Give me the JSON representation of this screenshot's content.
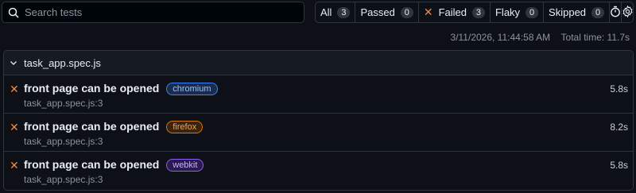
{
  "search": {
    "placeholder": "Search tests"
  },
  "filters": [
    {
      "label": "All",
      "count": "3"
    },
    {
      "label": "Passed",
      "count": "0"
    },
    {
      "label": "Failed",
      "count": "3"
    },
    {
      "label": "Flaky",
      "count": "0"
    },
    {
      "label": "Skipped",
      "count": "0"
    }
  ],
  "meta": {
    "datetime": "3/11/2026, 11:44:58 AM",
    "total_time": "Total time: 11.7s"
  },
  "file": {
    "name": "task_app.spec.js"
  },
  "tests": [
    {
      "title": "front page can be opened",
      "project": "chromium",
      "location": "task_app.spec.js:3",
      "duration": "5.8s",
      "badge_color": "#3b82f6",
      "badge_bg": "#1a2b4d",
      "badge_text": "#93c5fd"
    },
    {
      "title": "front page can be opened",
      "project": "firefox",
      "location": "task_app.spec.js:3",
      "duration": "8.2s",
      "badge_color": "#d97706",
      "badge_bg": "#3a2410",
      "badge_text": "#f0a850"
    },
    {
      "title": "front page can be opened",
      "project": "webkit",
      "location": "task_app.spec.js:3",
      "duration": "5.8s",
      "badge_color": "#8b5cf6",
      "badge_bg": "#2b1a4d",
      "badge_text": "#c4b5fd"
    }
  ],
  "colors": {
    "failed": "#f0883e",
    "background": "#0d1117",
    "border": "#30363d"
  },
  "icons": {
    "search": "search-icon",
    "failed": "x-icon",
    "speed": "stopwatch-icon",
    "settings": "gear-icon",
    "collapse": "chevron-down-icon"
  }
}
